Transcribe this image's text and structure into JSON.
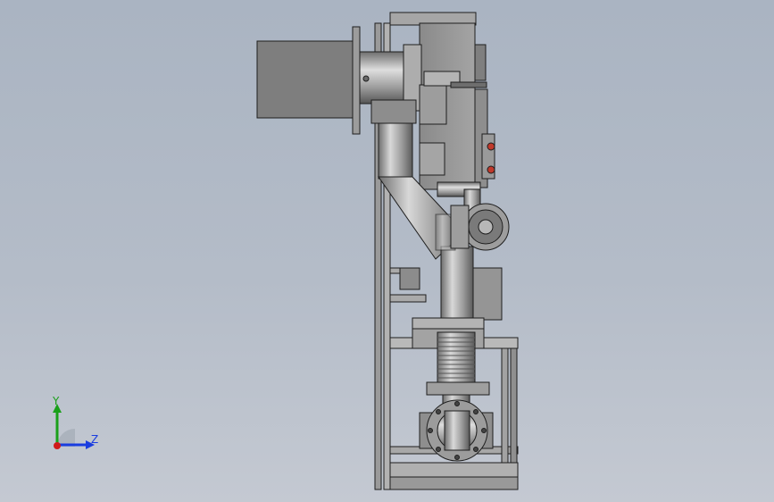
{
  "triad": {
    "y_label": "Y",
    "z_label": "Z",
    "colors": {
      "y": "#1aa01a",
      "z": "#1a3de0",
      "x": "#d01a1a"
    }
  },
  "model": {
    "fill_light": "#b9b9b9",
    "fill_mid": "#8f8f8f",
    "fill_dark": "#5c5c5c",
    "outline": "#1e1e1e",
    "accent_red": "#c0392b"
  }
}
